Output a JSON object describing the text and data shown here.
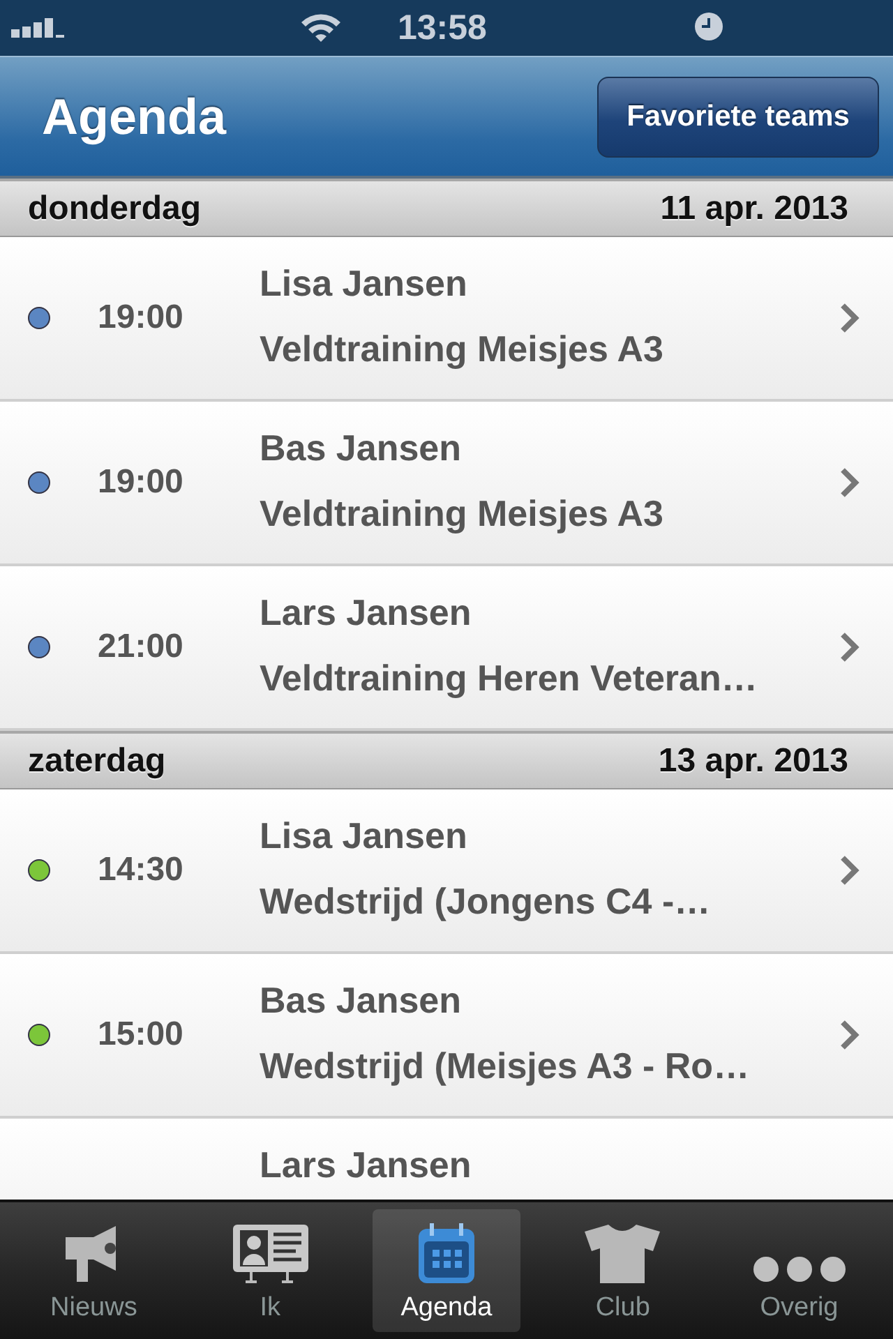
{
  "status_bar": {
    "time": "13:58"
  },
  "nav_bar": {
    "title": "Agenda",
    "button": "Favoriete teams"
  },
  "sections": [
    {
      "day": "donderdag",
      "date": "11 apr. 2013",
      "events": [
        {
          "time": "19:00",
          "name": "Lisa Jansen",
          "title": "Veldtraining Meisjes A3",
          "color": "#5b86c2"
        },
        {
          "time": "19:00",
          "name": "Bas Jansen",
          "title": "Veldtraining Meisjes A3",
          "color": "#5b86c2"
        },
        {
          "time": "21:00",
          "name": "Lars Jansen",
          "title": "Veldtraining Heren Veteran…",
          "color": "#5b86c2"
        }
      ]
    },
    {
      "day": "zaterdag",
      "date": "13 apr. 2013",
      "events": [
        {
          "time": "14:30",
          "name": "Lisa Jansen",
          "title": "Wedstrijd (Jongens C4 -…",
          "color": "#7cc63a"
        },
        {
          "time": "15:00",
          "name": "Bas Jansen",
          "title": "Wedstrijd (Meisjes A3 - Ro…",
          "color": "#7cc63a"
        },
        {
          "name": "Lars Jansen"
        }
      ]
    }
  ],
  "tab_bar": [
    {
      "label": "Nieuws",
      "kind": "megaphone",
      "selected": false
    },
    {
      "label": "Ik",
      "kind": "card",
      "selected": false
    },
    {
      "label": "Agenda",
      "kind": "calendar",
      "selected": true
    },
    {
      "label": "Club",
      "kind": "shirt",
      "selected": false
    },
    {
      "label": "Overig",
      "kind": "dots",
      "selected": false
    }
  ]
}
